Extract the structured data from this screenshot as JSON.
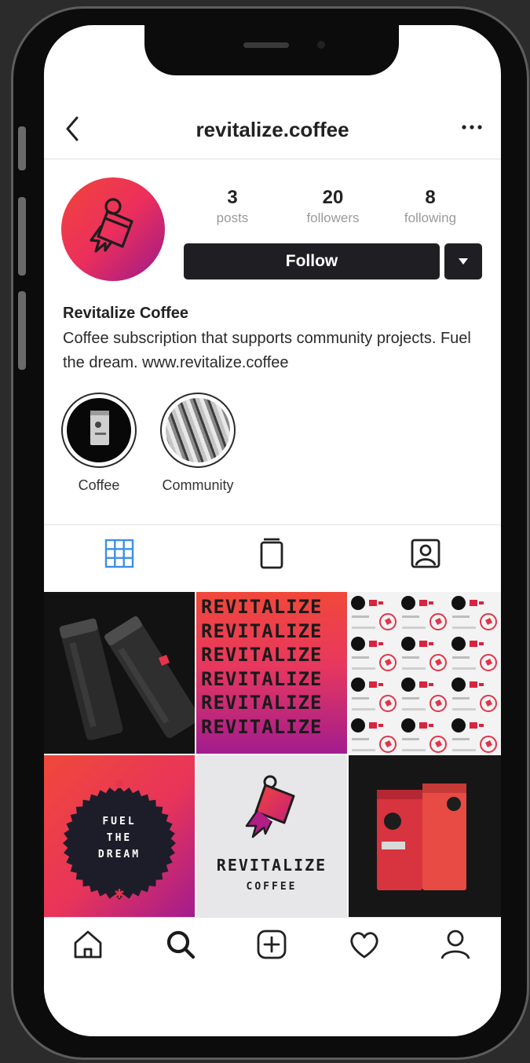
{
  "colors": {
    "accent_start": "#f0453a",
    "accent_mid": "#ec2f5c",
    "accent_end": "#9c1a8a",
    "button_dark": "#1f1f23",
    "tab_active": "#3d8fe6"
  },
  "header": {
    "back_icon": "chevron-left-icon",
    "username": "revitalize.coffee",
    "more_icon": "more-horizontal-icon"
  },
  "profile": {
    "avatar_icon": "revitalize-logo-icon",
    "stats": [
      {
        "value": "3",
        "label": "posts"
      },
      {
        "value": "20",
        "label": "followers"
      },
      {
        "value": "8",
        "label": "following"
      }
    ],
    "follow_label": "Follow",
    "dropdown_icon": "caret-down-icon",
    "name": "Revitalize Coffee",
    "bio": "Coffee subscription that supports community projects. Fuel the dream. www.revitalize.coffee"
  },
  "highlights": [
    {
      "label": "Coffee"
    },
    {
      "label": "Community"
    }
  ],
  "tabs": [
    {
      "icon": "grid-icon",
      "active": true
    },
    {
      "icon": "igtv-icon",
      "active": false
    },
    {
      "icon": "tagged-user-icon",
      "active": false
    }
  ],
  "posts": {
    "revitalize_lines": [
      "REVITALIZE",
      "REVITALIZE",
      "REVITALIZE",
      "REVITALIZE",
      "REVITALIZE",
      "REVITALIZE"
    ],
    "badge_lines": [
      "FUEL",
      "THE",
      "DREAM"
    ],
    "logo_brand": "REVITALIZE",
    "logo_sub": "COFFEE"
  },
  "bottom_nav": [
    {
      "icon": "home-icon"
    },
    {
      "icon": "search-icon"
    },
    {
      "icon": "add-post-icon"
    },
    {
      "icon": "heart-icon"
    },
    {
      "icon": "profile-icon"
    }
  ]
}
